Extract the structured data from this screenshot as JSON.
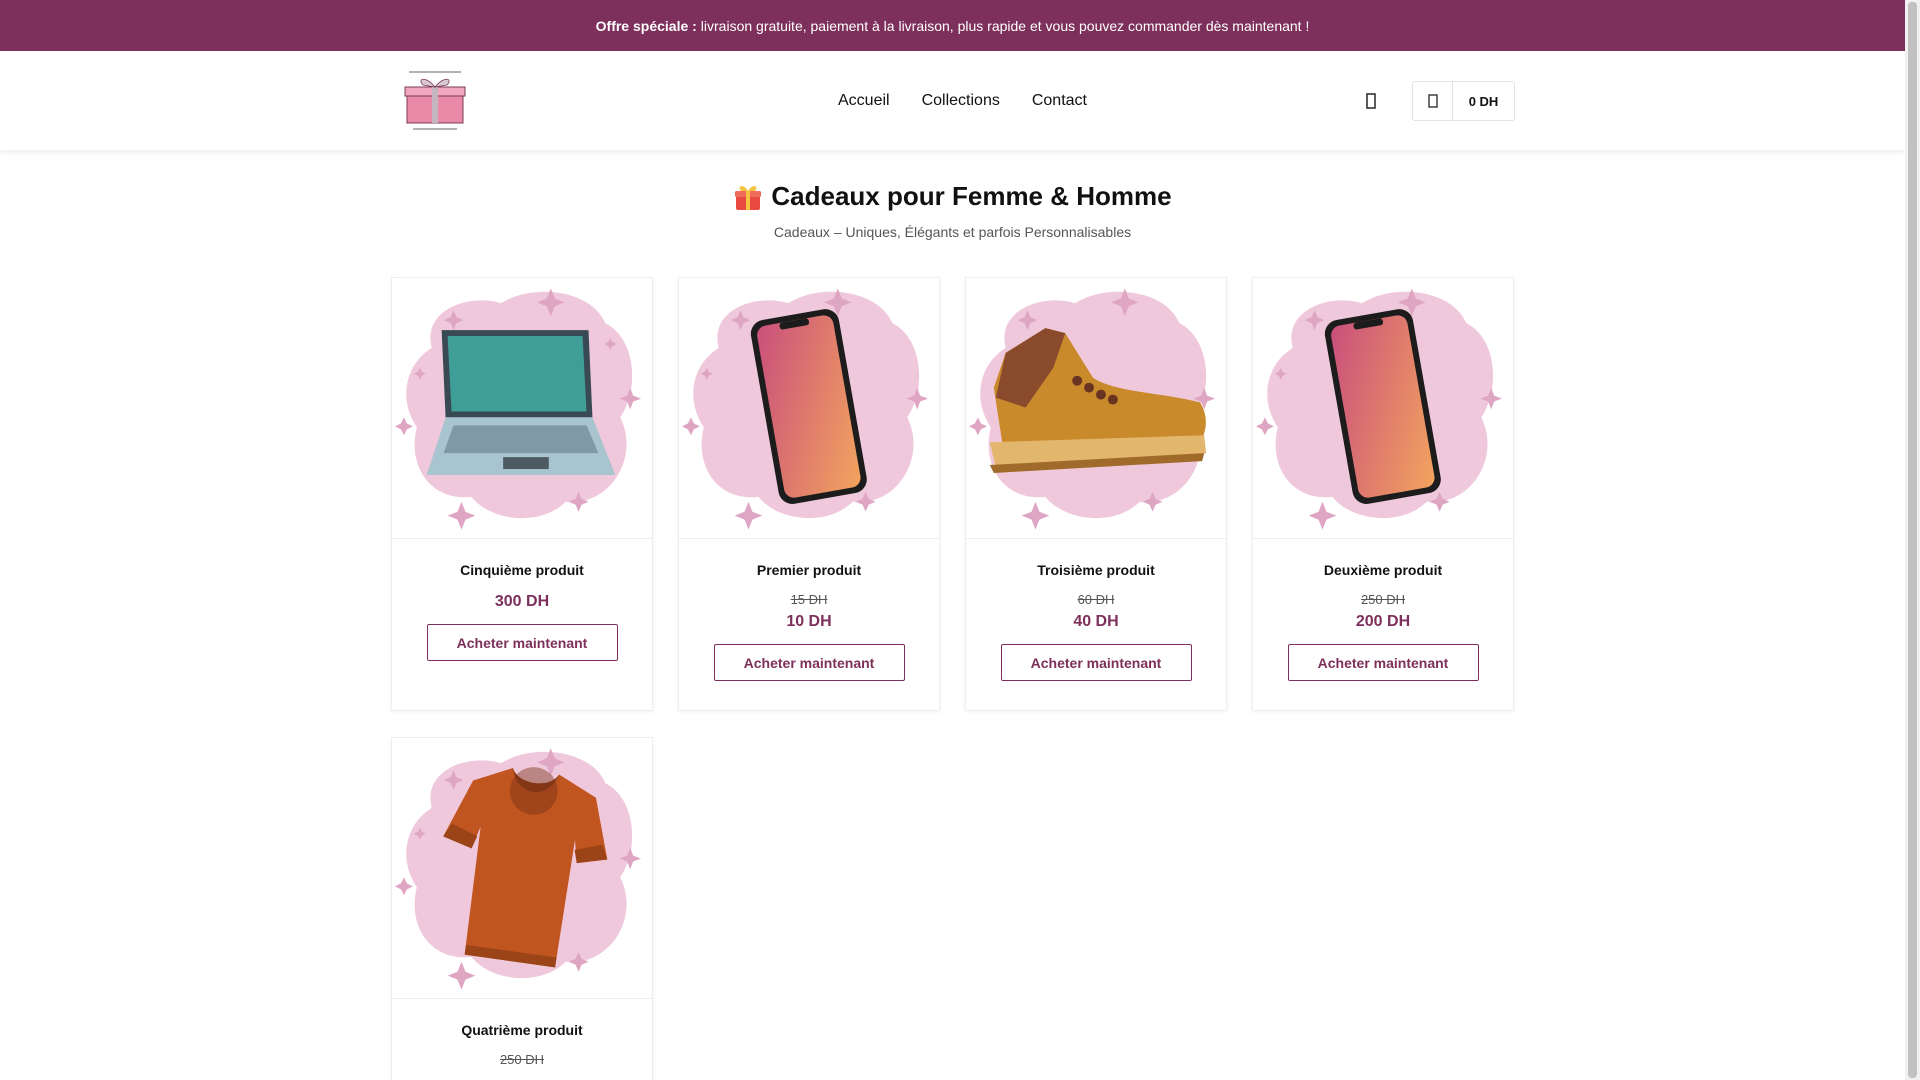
{
  "announcement": {
    "label": "Offre spéciale :",
    "text": "livraison gratuite, paiement à la livraison, plus rapide et vous pouvez commander dès maintenant !"
  },
  "header": {
    "logo_icon": "gift-box-logo",
    "nav": [
      "Accueil",
      "Collections",
      "Contact"
    ],
    "search_icon": "search-icon",
    "cart_icon": "shopping-bag-icon",
    "cart_amount": "0 DH"
  },
  "page": {
    "title": "Cadeaux pour Femme & Homme",
    "title_icon": "gift-emoji",
    "subtitle": "Cadeaux – Uniques, Élégants et parfois Personnalisables"
  },
  "products": [
    {
      "name": "Cinquième produit",
      "old_price": "",
      "price": "300 DH",
      "button": "Acheter maintenant",
      "image": "laptop"
    },
    {
      "name": "Premier produit",
      "old_price": "15 DH",
      "price": "10 DH",
      "button": "Acheter maintenant",
      "image": "phone"
    },
    {
      "name": "Troisième produit",
      "old_price": "60 DH",
      "price": "40 DH",
      "button": "Acheter maintenant",
      "image": "boot"
    },
    {
      "name": "Deuxième produit",
      "old_price": "250 DH",
      "price": "200 DH",
      "button": "Acheter maintenant",
      "image": "phone"
    },
    {
      "name": "Quatrième produit",
      "old_price": "250 DH",
      "price": "",
      "button": "",
      "image": "tshirt"
    }
  ],
  "colors": {
    "brand": "#7d305b",
    "blob": "#f0c8dc",
    "sparkle": "#dfa6c4"
  }
}
